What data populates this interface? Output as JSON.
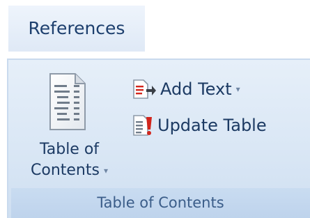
{
  "tab": {
    "label": "References"
  },
  "group": {
    "label": "Table of Contents",
    "toc_button": {
      "line1": "Table of",
      "line2": "Contents",
      "dropdown_glyph": "▾",
      "icon": "toc-document-icon"
    },
    "add_text_button": {
      "label": "Add Text",
      "dropdown_glyph": "▾",
      "icon": "add-text-icon"
    },
    "update_table_button": {
      "label": "Update Table",
      "icon": "update-table-icon"
    }
  },
  "colors": {
    "text": "#1c3a63",
    "ribbon_bg": "#dae7f5",
    "group_label_bg": "#c3d7ee",
    "alert_red": "#d2251c"
  }
}
